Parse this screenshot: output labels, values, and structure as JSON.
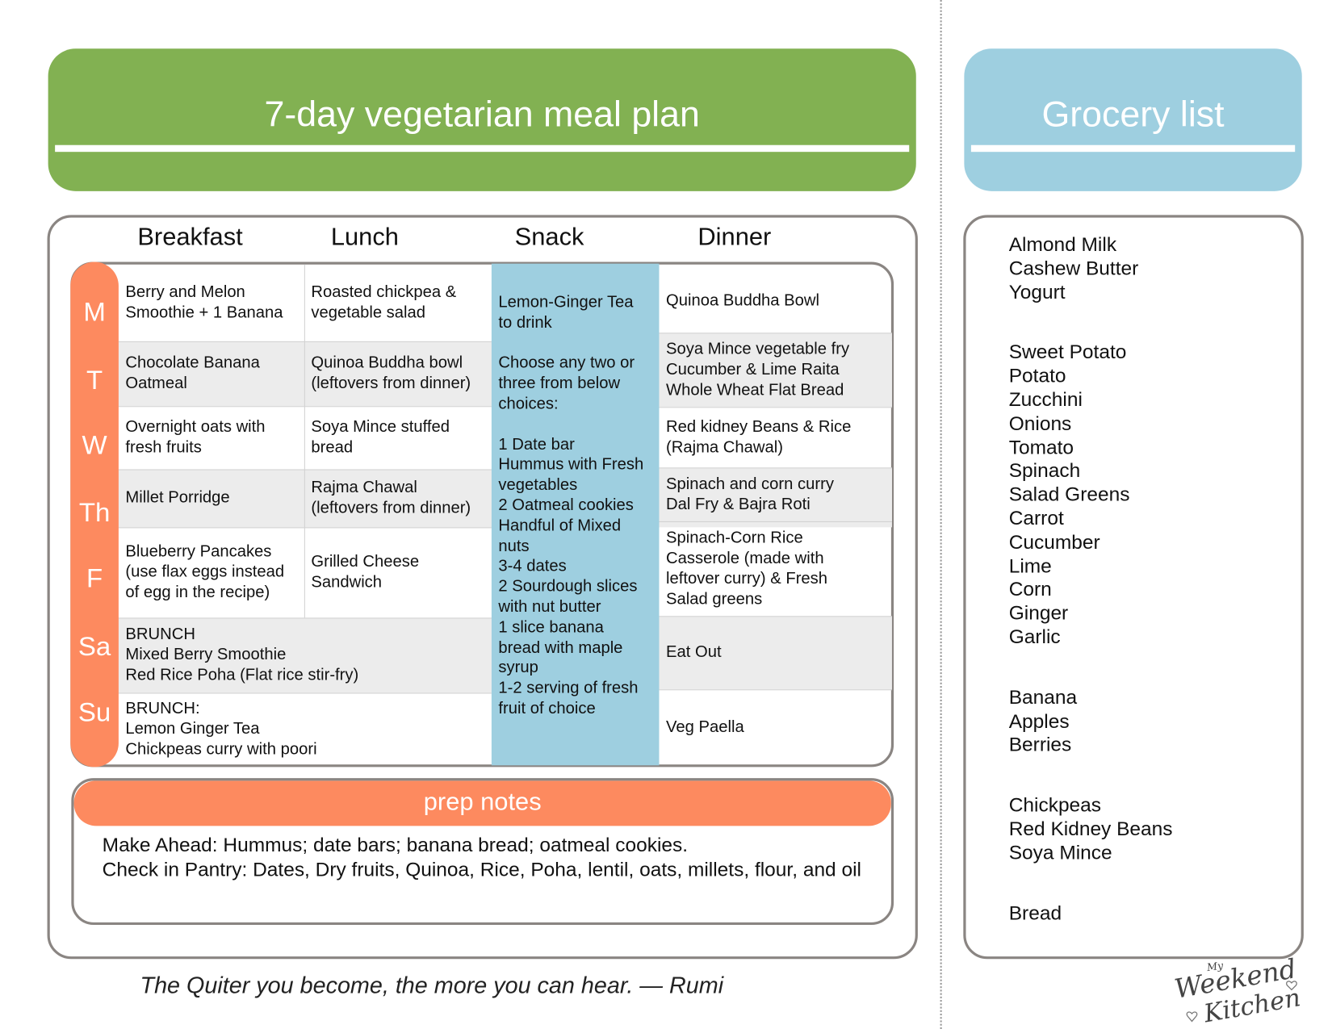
{
  "header": {
    "title": "7-day vegetarian meal plan",
    "grocery_title": "Grocery list"
  },
  "colors": {
    "green": "#82b152",
    "blue": "#9ecfe0",
    "orange": "#fd8a5f",
    "border": "#8a8582",
    "row_grey": "#ececec"
  },
  "columns": [
    "Breakfast",
    "Lunch",
    "Snack",
    "Dinner"
  ],
  "days": [
    {
      "label": "M",
      "breakfast": "Berry and Melon\nSmoothie + 1 Banana",
      "lunch": "Roasted chickpea &\nvegetable salad",
      "dinner": "Quinoa Buddha Bowl"
    },
    {
      "label": "T",
      "breakfast": "Chocolate Banana\nOatmeal",
      "lunch": "Quinoa Buddha bowl\n(leftovers from dinner)",
      "dinner": "Soya Mince vegetable fry\nCucumber & Lime Raita\nWhole Wheat Flat Bread"
    },
    {
      "label": "W",
      "breakfast": "Overnight oats with\nfresh fruits",
      "lunch": "Soya Mince stuffed\nbread",
      "dinner": "Red kidney Beans & Rice\n(Rajma Chawal)"
    },
    {
      "label": "Th",
      "breakfast": "Millet Porridge",
      "lunch": "Rajma Chawal\n(leftovers from dinner)",
      "dinner": "Spinach and corn curry\nDal Fry & Bajra Roti"
    },
    {
      "label": "F",
      "breakfast": "Blueberry Pancakes\n(use flax eggs instead\nof egg in the recipe)",
      "lunch": "Grilled Cheese\nSandwich",
      "dinner": "Spinach-Corn Rice\nCasserole (made with\nleftover curry)  & Fresh\nSalad greens"
    },
    {
      "label": "Sa",
      "brunch": "BRUNCH\nMixed Berry Smoothie\nRed Rice Poha (Flat rice stir-fry)",
      "dinner": "Eat Out"
    },
    {
      "label": "Su",
      "brunch": "BRUNCH:\nLemon Ginger Tea\nChickpeas curry with poori",
      "dinner": "Veg Paella"
    }
  ],
  "snack": "Lemon-Ginger Tea\nto drink\n\nChoose any two or\nthree from below\nchoices:\n\n1 Date bar\nHummus with Fresh\nvegetables\n2 Oatmeal cookies\nHandful of Mixed\nnuts\n3-4 dates\n2 Sourdough slices\nwith nut butter\n1 slice banana\nbread with maple\nsyrup\n1-2 serving of fresh\nfruit of choice",
  "prep": {
    "title": "prep notes",
    "make_ahead": "Make Ahead: Hummus; date bars; banana bread; oatmeal cookies.",
    "pantry": "Check in Pantry: Dates, Dry fruits, Quinoa, Rice, Poha, lentil, oats, millets, flour, and oil"
  },
  "grocery": [
    [
      "Almond Milk",
      "Cashew Butter",
      "Yogurt"
    ],
    [
      "Sweet Potato",
      "Potato",
      "Zucchini",
      "Onions",
      "Tomato",
      "Spinach",
      "Salad Greens",
      "Carrot",
      "Cucumber",
      "Lime",
      "Corn",
      "Ginger",
      "Garlic"
    ],
    [
      "Banana",
      "Apples",
      "Berries"
    ],
    [
      "Chickpeas",
      "Red Kidney Beans",
      "Soya Mince"
    ],
    [
      "Bread"
    ]
  ],
  "quote": "The Quiter you become, the more you can hear. — Rumi",
  "logo": {
    "small": "My",
    "line1": "Weekend",
    "line2": "Kitchen"
  }
}
